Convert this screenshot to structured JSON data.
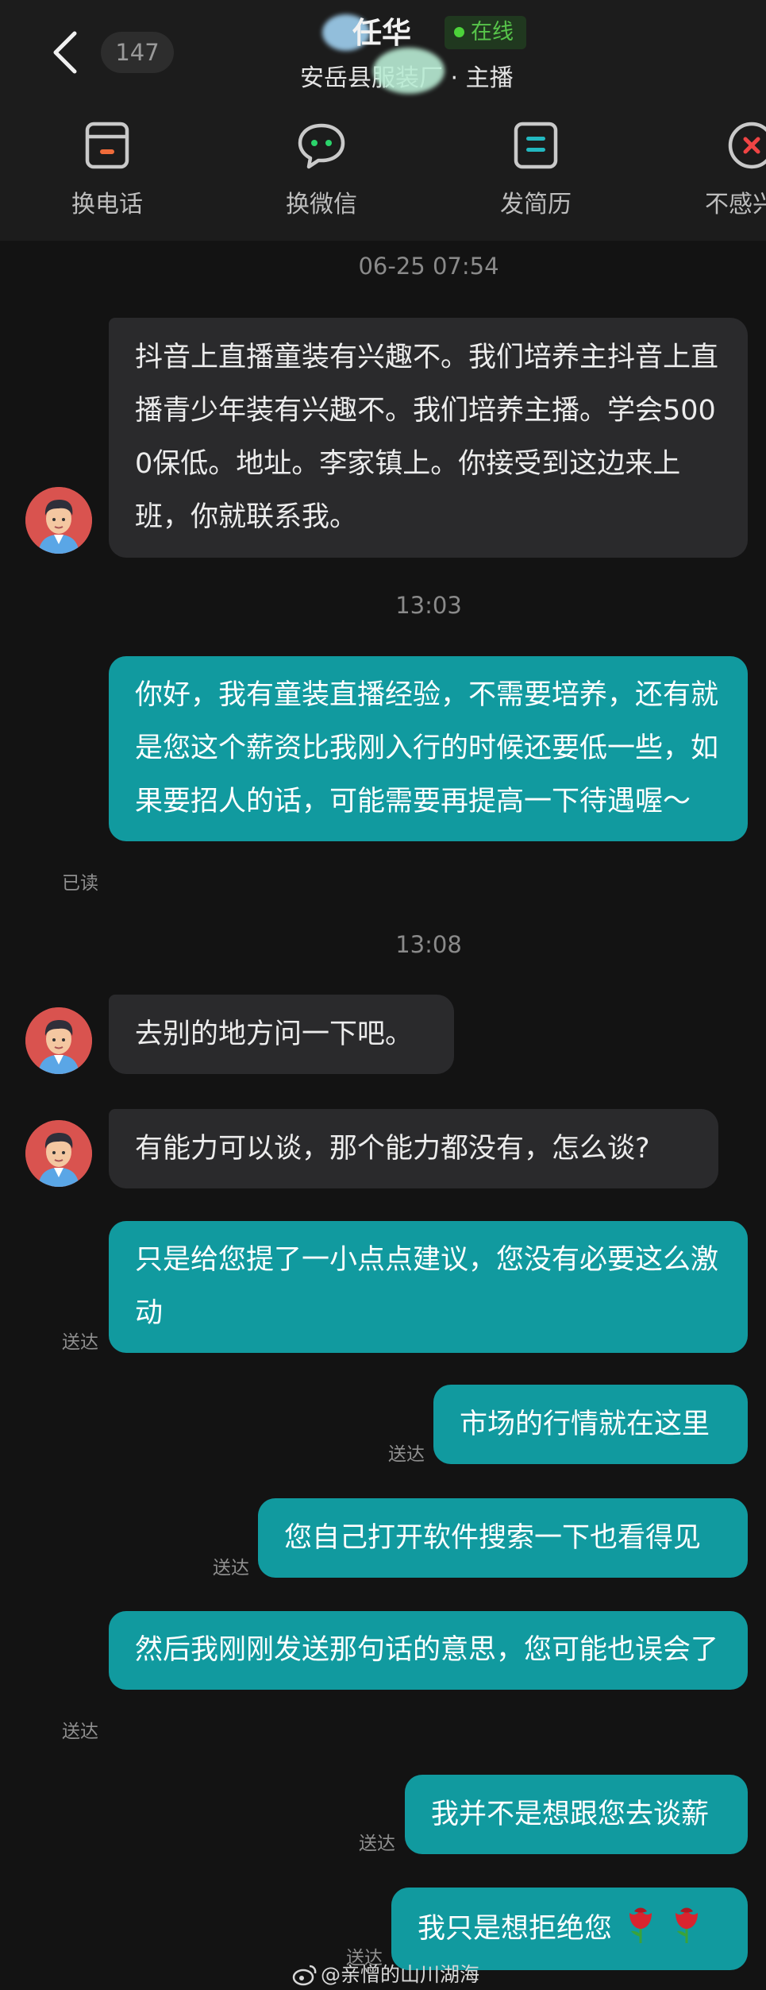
{
  "header": {
    "unread_count": "147",
    "contact_name": "任华",
    "online_status": "在线",
    "subtitle": "安岳县服装厂 · 主播",
    "actions": [
      {
        "label": "换电话",
        "icon": "phone-card-icon"
      },
      {
        "label": "换微信",
        "icon": "wechat-bubble-icon"
      },
      {
        "label": "发简历",
        "icon": "resume-icon"
      },
      {
        "label": "不感兴",
        "icon": "not-interested-icon"
      }
    ]
  },
  "messages": [
    {
      "type": "time",
      "text": "06-25 07:54"
    },
    {
      "type": "in",
      "text": "抖音上直播童装有兴趣不。我们培养主抖音上直播青少年装有兴趣不。我们培养主播。学会5000保低。地址。李家镇上。你接受到这边来上班，你就联系我。"
    },
    {
      "type": "time",
      "text": "13:03"
    },
    {
      "type": "out",
      "status": "已读",
      "text": "你好，我有童装直播经验，不需要培养，还有就是您这个薪资比我刚入行的时候还要低一些，如果要招人的话，可能需要再提高一下待遇喔～"
    },
    {
      "type": "time",
      "text": "13:08"
    },
    {
      "type": "in",
      "text": "去别的地方问一下吧。"
    },
    {
      "type": "in",
      "text": "有能力可以谈，那个能力都没有，怎么谈?"
    },
    {
      "type": "out",
      "status": "送达",
      "text": "只是给您提了一小点点建议，您没有必要这么激动"
    },
    {
      "type": "out",
      "status": "送达",
      "text": "市场的行情就在这里"
    },
    {
      "type": "out",
      "status": "送达",
      "text": "您自己打开软件搜索一下也看得见"
    },
    {
      "type": "out",
      "status": "送达",
      "text": "然后我刚刚发送那句话的意思，您可能也误会了"
    },
    {
      "type": "out",
      "status": "送达",
      "text": "我并不是想跟您去谈薪"
    },
    {
      "type": "out",
      "status": "送达",
      "text": "我只是想拒绝您",
      "emoji": "rose-icon x2"
    }
  ],
  "watermark": "@亲憎的山川湖海",
  "colors": {
    "background": "#131313",
    "header_bg": "#1c1c1c",
    "incoming_bubble": "#2a2a2c",
    "outgoing_bubble": "#119a9f",
    "online_green": "#57c44a"
  }
}
